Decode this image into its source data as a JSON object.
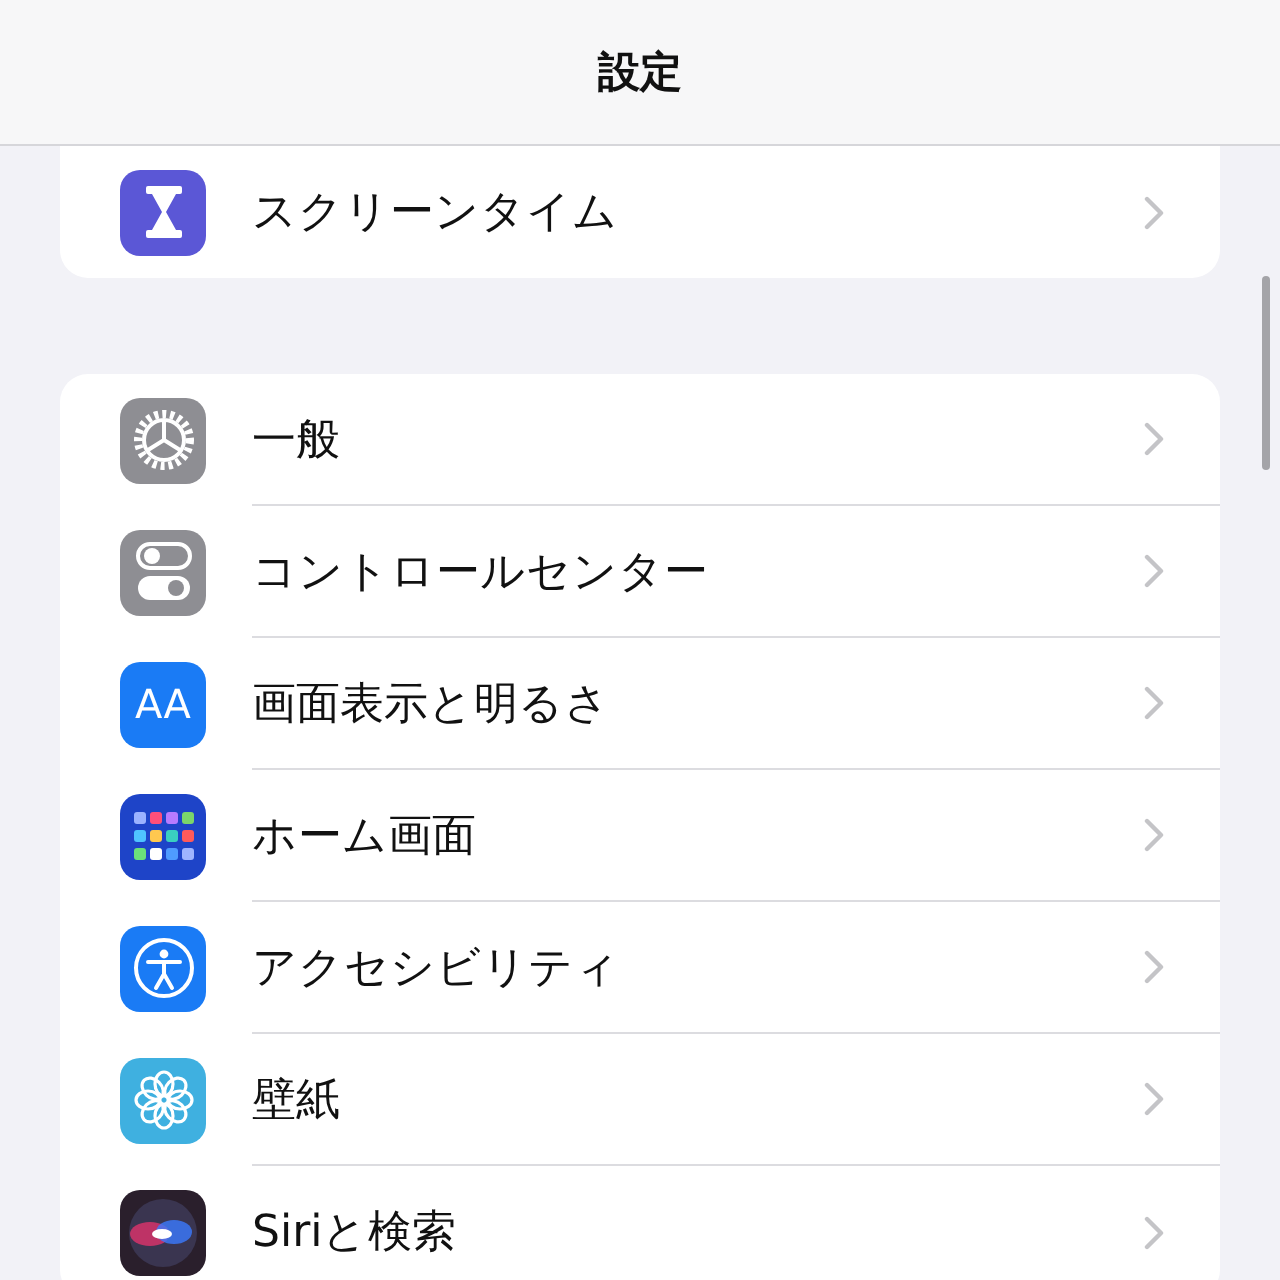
{
  "nav_bar": {
    "title": "設定"
  },
  "groups": [
    {
      "items": [
        {
          "kind": "hourglass",
          "label": "スクリーンタイム"
        }
      ]
    },
    {
      "items": [
        {
          "kind": "gear",
          "label": "一般"
        },
        {
          "kind": "toggles",
          "label": "コントロールセンター"
        },
        {
          "kind": "text",
          "glyph": "AA",
          "label": "画面表示と明るさ"
        },
        {
          "kind": "grid",
          "label": "ホーム画面"
        },
        {
          "kind": "accessibility",
          "label": "アクセシビリティ"
        },
        {
          "kind": "flower",
          "label": "壁紙"
        },
        {
          "kind": "orb",
          "label": "Siriと検索"
        }
      ]
    }
  ]
}
